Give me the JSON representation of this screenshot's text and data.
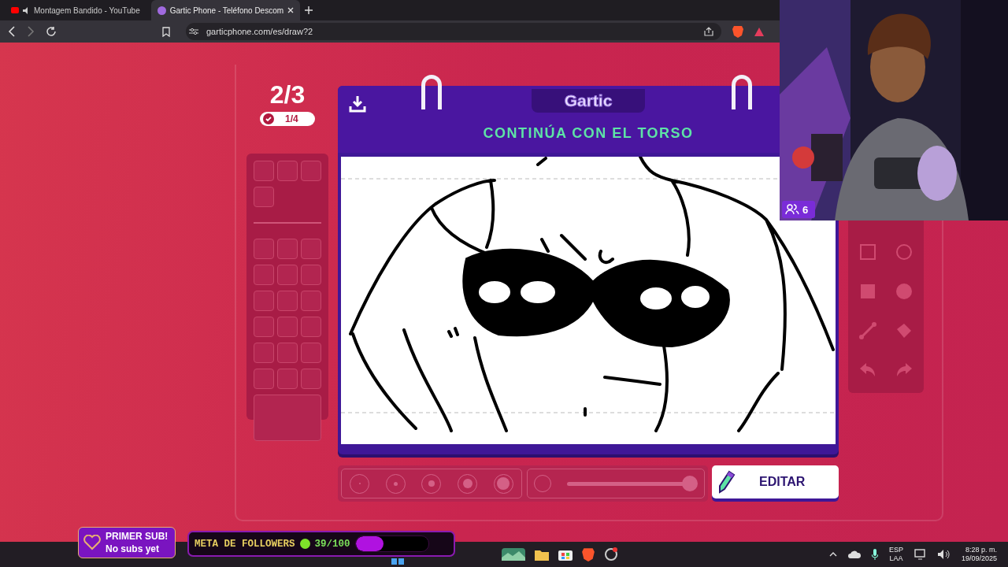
{
  "browser": {
    "tabs": [
      {
        "title": "Montagem Bandido - YouTube",
        "selected": false
      },
      {
        "title": "Gartic Phone - Teléfono Descom",
        "selected": true
      }
    ],
    "address": "garticphone.com/es/draw?2"
  },
  "game": {
    "round": "2/3",
    "progress": "1/4",
    "logo": "Gartic",
    "prompt": "CONTINÚA CON EL TORSO",
    "opacity_slider": {
      "level": 1
    },
    "edit_button": "EDITAR"
  },
  "webcam": {
    "viewers": "6"
  },
  "sub_alert": {
    "title": "PRIMER SUB!",
    "subtitle": "No subs yet"
  },
  "follower_goal": {
    "label": "META DE FOLLOWERS",
    "count": "39/100",
    "level": 0.39
  },
  "taskbar": {
    "language": "ESP",
    "layout": "LAA",
    "time": "8:28 p. m.",
    "date": "19/09/2025"
  }
}
